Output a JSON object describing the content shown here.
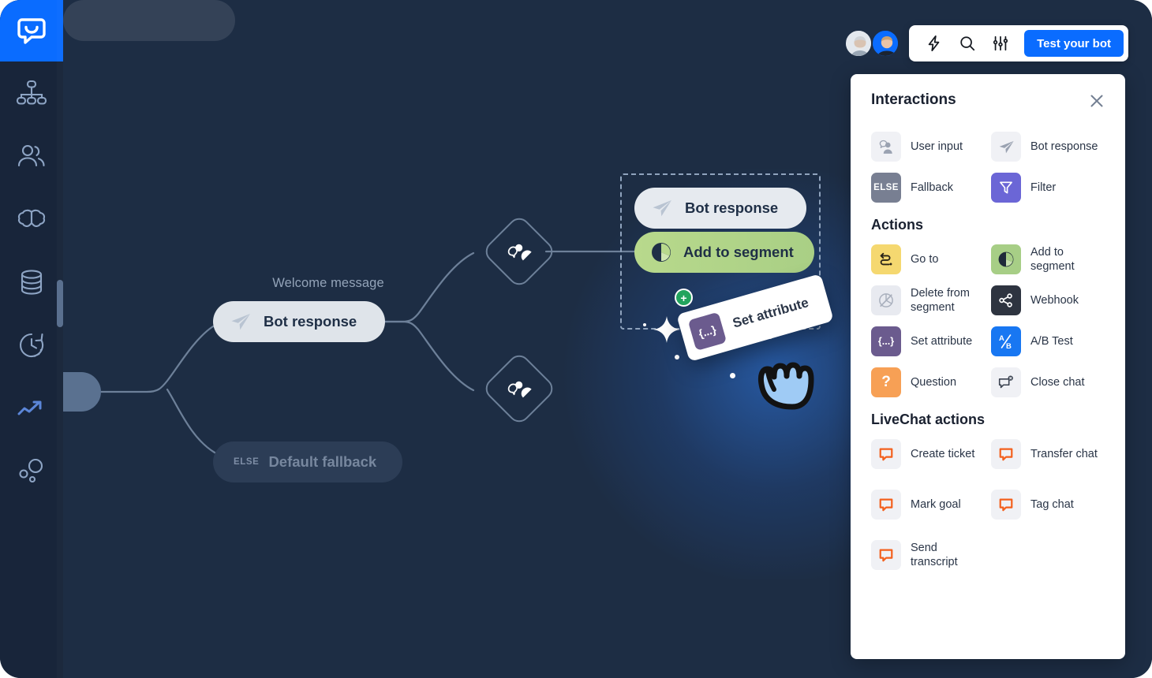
{
  "app": {
    "logo_icon": "chatbot-logo-icon",
    "canvas_background": "#1d2d44",
    "accent_color": "#0a6cff"
  },
  "sidebar": {
    "items": [
      {
        "icon": "flow-chart-icon",
        "name": "stories"
      },
      {
        "icon": "users-icon",
        "name": "users"
      },
      {
        "icon": "brain-icon",
        "name": "training"
      },
      {
        "icon": "database-icon",
        "name": "knowledge-base"
      },
      {
        "icon": "clock-history-icon",
        "name": "archives"
      },
      {
        "icon": "trend-up-icon",
        "name": "reports"
      },
      {
        "icon": "bubbles-icon",
        "name": "integrations"
      }
    ]
  },
  "topbar": {
    "avatars": [
      {
        "name": "avatar-user-1"
      },
      {
        "name": "avatar-user-2"
      }
    ],
    "icons": [
      {
        "name": "lightning-icon"
      },
      {
        "name": "search-icon"
      },
      {
        "name": "sliders-icon"
      }
    ],
    "test_bot_label": "Test your bot"
  },
  "canvas": {
    "welcome_label": "Welcome message",
    "nodes": [
      {
        "id": "start",
        "label": "",
        "type": "start"
      },
      {
        "id": "welcome",
        "label": "Bot response",
        "type": "bot-response"
      },
      {
        "id": "fallback",
        "label": "Default fallback",
        "tag": "ELSE",
        "type": "fallback"
      },
      {
        "id": "bot-response",
        "label": "Bot response",
        "type": "bot-response"
      },
      {
        "id": "add-segment",
        "label": "Add to segment",
        "type": "add-to-segment"
      },
      {
        "id": "empty-slot",
        "label": "",
        "type": "placeholder"
      },
      {
        "id": "user-input-1",
        "label": "",
        "type": "user-input"
      },
      {
        "id": "user-input-2",
        "label": "",
        "type": "user-input"
      }
    ],
    "drag_card": {
      "label": "Set attribute",
      "icon_glyph": "{...}",
      "badge": "+",
      "cursor": "hand-grab-cursor"
    }
  },
  "panel": {
    "title": "Interactions",
    "close_icon": "close-icon",
    "interactions": [
      {
        "label": "User input",
        "icon": "user-input-icon",
        "tile": "t-grey"
      },
      {
        "label": "Bot response",
        "icon": "paper-plane-icon",
        "tile": "t-grey"
      },
      {
        "label": "Fallback",
        "icon": "else-icon",
        "tile": "t-dkgrey",
        "glyph": "ELSE"
      },
      {
        "label": "Filter",
        "icon": "funnel-icon",
        "tile": "t-purple"
      }
    ],
    "actions_title": "Actions",
    "actions": [
      {
        "label": "Go to",
        "icon": "goto-arrow-icon",
        "tile": "t-yellow"
      },
      {
        "label": "Add to segment",
        "icon": "pie-chart-icon",
        "tile": "t-green"
      },
      {
        "label": "Delete from segment",
        "icon": "pie-chart-slash-icon",
        "tile": "t-lgrey"
      },
      {
        "label": "Webhook",
        "icon": "share-nodes-icon",
        "tile": "t-dark"
      },
      {
        "label": "Set attribute",
        "icon": "braces-icon",
        "tile": "t-plum",
        "glyph": "{...}"
      },
      {
        "label": "A/B Test",
        "icon": "ab-test-icon",
        "tile": "t-blue",
        "glyph": "A/B"
      },
      {
        "label": "Question",
        "icon": "question-mark-icon",
        "tile": "t-orange",
        "glyph": "?"
      },
      {
        "label": "Close chat",
        "icon": "close-chat-icon",
        "tile": "t-grey"
      }
    ],
    "livechat_title": "LiveChat actions",
    "livechat_actions": [
      {
        "label": "Create ticket",
        "icon": "livechat-bubble-icon",
        "tile": "t-grey"
      },
      {
        "label": "Transfer chat",
        "icon": "livechat-bubble-icon",
        "tile": "t-grey"
      },
      {
        "label": "Mark goal",
        "icon": "livechat-bubble-icon",
        "tile": "t-grey"
      },
      {
        "label": "Tag chat",
        "icon": "livechat-bubble-icon",
        "tile": "t-grey"
      },
      {
        "label": "Send transcript",
        "icon": "livechat-bubble-icon",
        "tile": "t-grey"
      }
    ]
  }
}
